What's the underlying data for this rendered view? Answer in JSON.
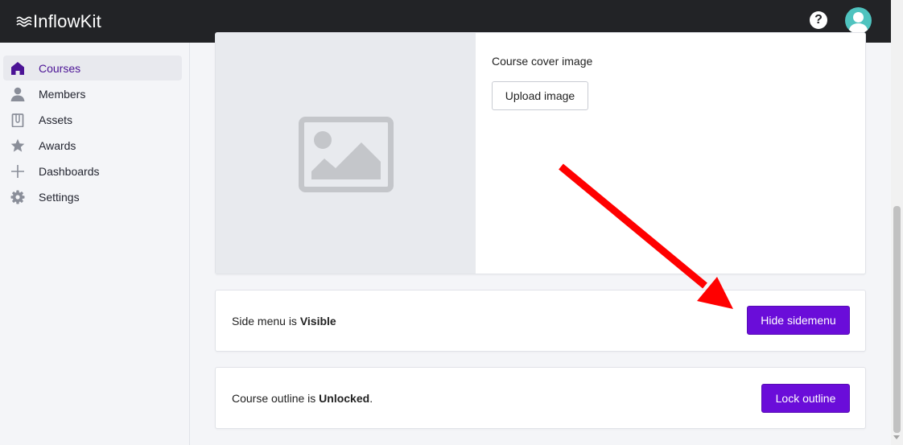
{
  "app": {
    "name": "InflowKit"
  },
  "header": {
    "help_icon": "question-circle-icon",
    "avatar_icon": "user-avatar-icon"
  },
  "sidebar": {
    "items": [
      {
        "label": "Courses",
        "icon": "home-icon",
        "active": true
      },
      {
        "label": "Members",
        "icon": "person-icon",
        "active": false
      },
      {
        "label": "Assets",
        "icon": "clipboard-icon",
        "active": false
      },
      {
        "label": "Awards",
        "icon": "star-icon",
        "active": false
      },
      {
        "label": "Dashboards",
        "icon": "plus-icon",
        "active": false
      },
      {
        "label": "Settings",
        "icon": "gear-icon",
        "active": false
      }
    ]
  },
  "cover": {
    "label": "Course cover image",
    "upload_label": "Upload image",
    "placeholder_icon": "image-placeholder-icon"
  },
  "side_menu_row": {
    "prefix": "Side menu is ",
    "state": "Visible",
    "button_label": "Hide sidemenu"
  },
  "outline_row": {
    "prefix": "Course outline is ",
    "state": "Unlocked",
    "suffix": ".",
    "button_label": "Lock outline"
  },
  "colors": {
    "topbar": "#222326",
    "accent": "#6a0dd9",
    "active_nav_text": "#4b1395",
    "avatar": "#4fc3bf",
    "annotation_arrow": "#ff0000"
  }
}
